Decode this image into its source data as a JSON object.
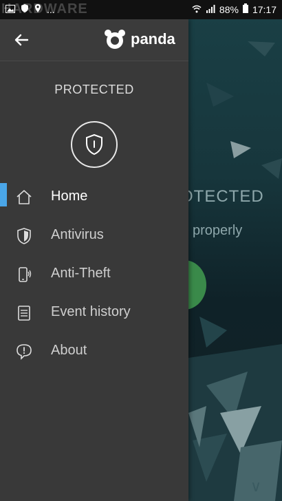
{
  "statusbar": {
    "battery": "88%",
    "time": "17:17",
    "dots": "...",
    "watermark": "HARDWARE"
  },
  "drawer": {
    "brand": "panda",
    "status_label": "PROTECTED",
    "menu": [
      {
        "label": "Home",
        "icon": "home-icon",
        "active": true
      },
      {
        "label": "Antivirus",
        "icon": "shield-icon",
        "active": false
      },
      {
        "label": "Anti-Theft",
        "icon": "phone-signal-icon",
        "active": false
      },
      {
        "label": "Event history",
        "icon": "list-icon",
        "active": false
      },
      {
        "label": "About",
        "icon": "info-bubble-icon",
        "active": false
      }
    ]
  },
  "background": {
    "status_text": "OTECTED",
    "sub_text": "properly"
  },
  "colors": {
    "drawer_bg": "#393939",
    "active_indicator": "#4aa6e8",
    "bg_app": "#17363c",
    "status_circle": "#3a8a4a"
  }
}
